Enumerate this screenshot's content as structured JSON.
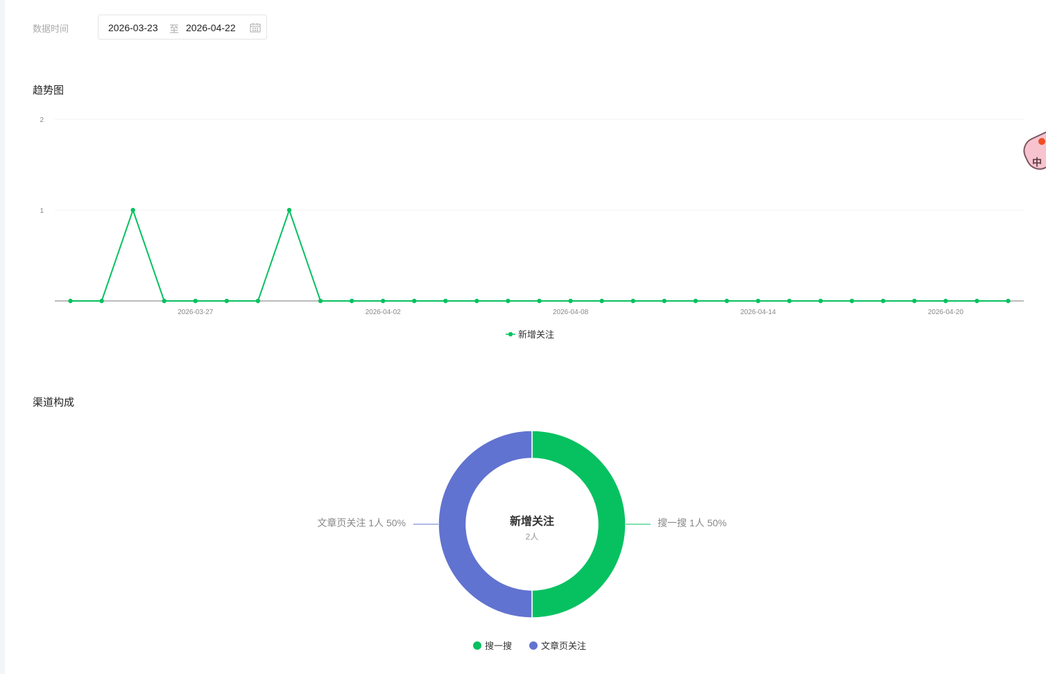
{
  "filter": {
    "label": "数据时间",
    "start": "2026-03-23",
    "separator": "至",
    "end": "2026-04-22",
    "icon": "calendar-icon"
  },
  "trend": {
    "title": "趋势图"
  },
  "channel": {
    "title": "渠道构成"
  },
  "widget": {
    "char": "中"
  },
  "colors": {
    "green": "#07c160",
    "blue": "#6173d0"
  },
  "chart_data": [
    {
      "type": "line",
      "title": "趋势图",
      "x": [
        "2026-03-23",
        "2026-03-24",
        "2026-03-25",
        "2026-03-26",
        "2026-03-27",
        "2026-03-28",
        "2026-03-29",
        "2026-03-30",
        "2026-03-31",
        "2026-04-01",
        "2026-04-02",
        "2026-04-03",
        "2026-04-04",
        "2026-04-05",
        "2026-04-06",
        "2026-04-07",
        "2026-04-08",
        "2026-04-09",
        "2026-04-10",
        "2026-04-11",
        "2026-04-12",
        "2026-04-13",
        "2026-04-14",
        "2026-04-15",
        "2026-04-16",
        "2026-04-17",
        "2026-04-18",
        "2026-04-19",
        "2026-04-20",
        "2026-04-21",
        "2026-04-22"
      ],
      "x_tick_labels": [
        "2026-03-27",
        "2026-04-02",
        "2026-04-08",
        "2026-04-14",
        "2026-04-20"
      ],
      "y_tick_labels": [
        "1",
        "2"
      ],
      "ylim": [
        0,
        2
      ],
      "series": [
        {
          "name": "新增关注",
          "values": [
            0,
            0,
            1,
            0,
            0,
            0,
            0,
            1,
            0,
            0,
            0,
            0,
            0,
            0,
            0,
            0,
            0,
            0,
            0,
            0,
            0,
            0,
            0,
            0,
            0,
            0,
            0,
            0,
            0,
            0,
            0
          ]
        }
      ],
      "legend": "bottom-center"
    },
    {
      "type": "pie",
      "title": "渠道构成",
      "center_title": "新增关注",
      "center_sub": "2人",
      "slices": [
        {
          "name": "搜一搜",
          "value": 1,
          "label": "搜一搜 1人 50%"
        },
        {
          "name": "文章页关注",
          "value": 1,
          "label": "文章页关注 1人 50%"
        }
      ],
      "legend": "bottom-center"
    }
  ]
}
